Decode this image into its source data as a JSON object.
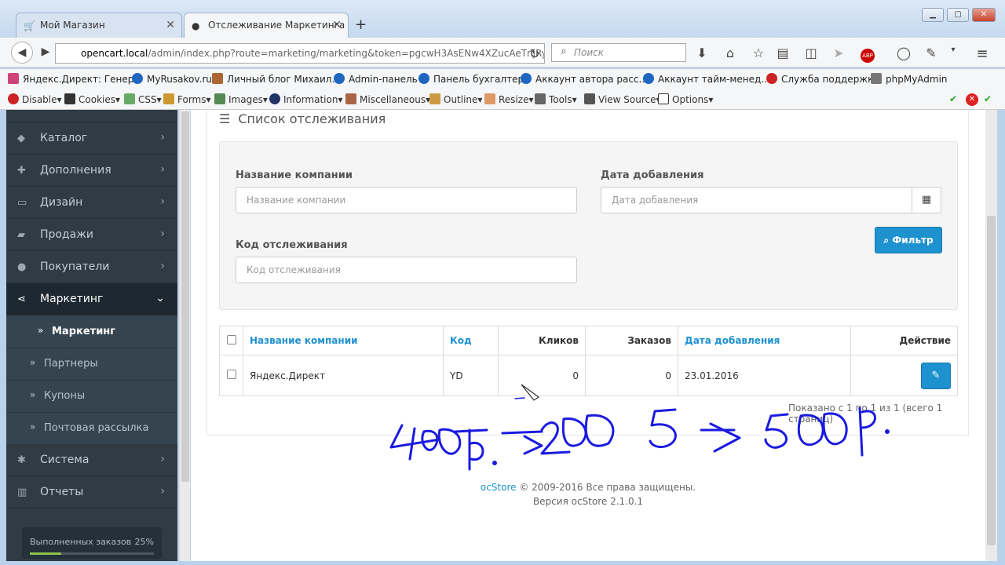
{
  "browser": {
    "tabs": [
      {
        "label": "Мой Магазин"
      },
      {
        "label": "Отслеживание Маркетинга"
      }
    ],
    "url_host": "opencart.local",
    "url_path": "/admin/index.php?route=marketing/marketing&token=pgcwH3AsENw4XZucAeTnjRy\\",
    "search_placeholder": "Поиск",
    "bookmarks": [
      "Яндекс.Директ: Генер...",
      "MyRusakov.ru",
      "Личный блог Михаил...",
      "Admin-панель",
      "Панель бухгалтера",
      "Аккаунт автора расс...",
      "Аккаунт тайм-менед...",
      "Служба поддержки",
      "phpMyAdmin"
    ],
    "webdev": [
      "Disable",
      "Cookies",
      "CSS",
      "Forms",
      "Images",
      "Information",
      "Miscellaneous",
      "Outline",
      "Resize",
      "Tools",
      "View Source",
      "Options"
    ]
  },
  "sidebar": {
    "items": [
      {
        "label": "Каталог",
        "icon": "tag-icon"
      },
      {
        "label": "Дополнения",
        "icon": "puzzle-icon"
      },
      {
        "label": "Дизайн",
        "icon": "monitor-icon"
      },
      {
        "label": "Продажи",
        "icon": "cart-icon"
      },
      {
        "label": "Покупатели",
        "icon": "user-icon"
      },
      {
        "label": "Маркетинг",
        "icon": "share-icon"
      }
    ],
    "sub_items": [
      "Маркетинг",
      "Партнеры",
      "Купоны",
      "Почтовая рассылка"
    ],
    "items2": [
      {
        "label": "Система",
        "icon": "cog-icon"
      },
      {
        "label": "Отчеты",
        "icon": "chart-icon"
      }
    ],
    "progress": {
      "label": "Выполненных заказов",
      "value_text": "25%",
      "value": 0.25
    }
  },
  "panel": {
    "title": "Список отслеживания",
    "filter": {
      "company_label": "Название компании",
      "company_placeholder": "Название компании",
      "date_label": "Дата добавления",
      "date_placeholder": "Дата добавления",
      "code_label": "Код отслеживания",
      "code_placeholder": "Код отслеживания",
      "button": "Фильтр"
    },
    "table": {
      "headers": {
        "name": "Название компании",
        "code": "Код",
        "clicks": "Кликов",
        "orders": "Заказов",
        "date": "Дата добавления",
        "action": "Действие"
      },
      "rows": [
        {
          "name": "Яндекс.Директ",
          "code": "YD",
          "clicks": "0",
          "orders": "0",
          "date": "23.01.2016"
        }
      ]
    },
    "pagination_text": "Показано с 1 по 1 из 1 (всего 1 страниц)"
  },
  "footer": {
    "brand": "ocStore",
    "copyright": "© 2009-2016 Все права защищены.",
    "version": "Версия ocStore 2.1.0.1"
  }
}
